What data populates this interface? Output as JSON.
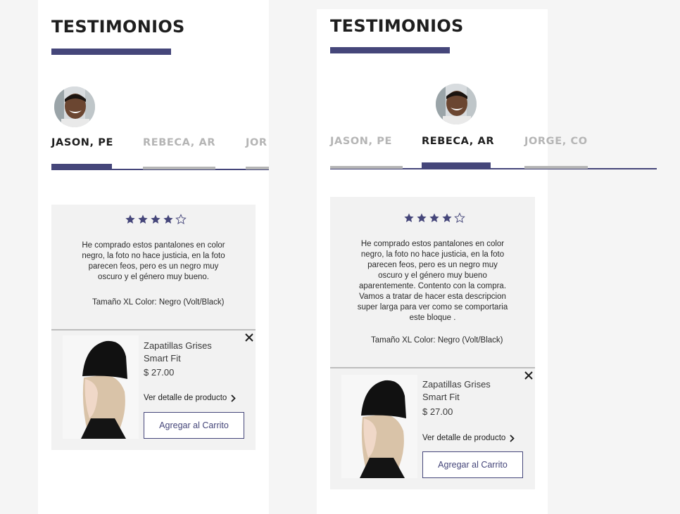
{
  "section_title": "TESTIMONIOS",
  "colors": {
    "accent": "#45467a",
    "inactive": "#b5b5b5",
    "card_bg": "#f2f2f2",
    "page_bg": "#f5f5f5"
  },
  "left_panel": {
    "tabs": [
      {
        "label": "JASON, PE",
        "state": "active"
      },
      {
        "label": "REBECA, AR",
        "state": "inactive"
      },
      {
        "label": "JOR",
        "state": "inactive"
      }
    ],
    "rating": {
      "value": 4,
      "max": 5
    },
    "review_lines": [
      "He comprado estos pantalones en color",
      "negro, la foto no hace justicia, en la foto",
      "parecen feos, pero es un negro muy",
      "oscuro y el género muy bueno."
    ],
    "meta": "Tamaño XL Color:  Negro (Volt/Black)",
    "product": {
      "name_lines": [
        "Zapatillas Grises",
        "Smart Fit"
      ],
      "price": "$  27.00",
      "detail_link": "Ver detalle de producto",
      "cart_button": "Agregar al Carrito"
    }
  },
  "right_panel": {
    "tabs": [
      {
        "label": "JASON, PE",
        "state": "inactive"
      },
      {
        "label": "REBECA, AR",
        "state": "active"
      },
      {
        "label": "JORGE, CO",
        "state": "inactive"
      }
    ],
    "rating": {
      "value": 4,
      "max": 5
    },
    "review_lines": [
      "He comprado estos pantalones en color",
      "negro, la foto no hace justicia, en la foto",
      "parecen feos, pero es un negro muy",
      "oscuro y el género muy bueno",
      "aparentemente. Contento con la compra.",
      "Vamos a tratar de hacer esta descripcion",
      "super larga para ver como se comportaria",
      "este bloque ."
    ],
    "meta": "Tamaño XL Color:  Negro (Volt/Black)",
    "product": {
      "name_lines": [
        "Zapatillas Grises",
        "Smart Fit"
      ],
      "price": "$  27.00",
      "detail_link": "Ver detalle de producto",
      "cart_button": "Agregar al Carrito"
    }
  },
  "icons": {
    "star": "star-icon",
    "close": "close-icon",
    "chevron": "chevron-right-icon",
    "avatar": "avatar"
  }
}
